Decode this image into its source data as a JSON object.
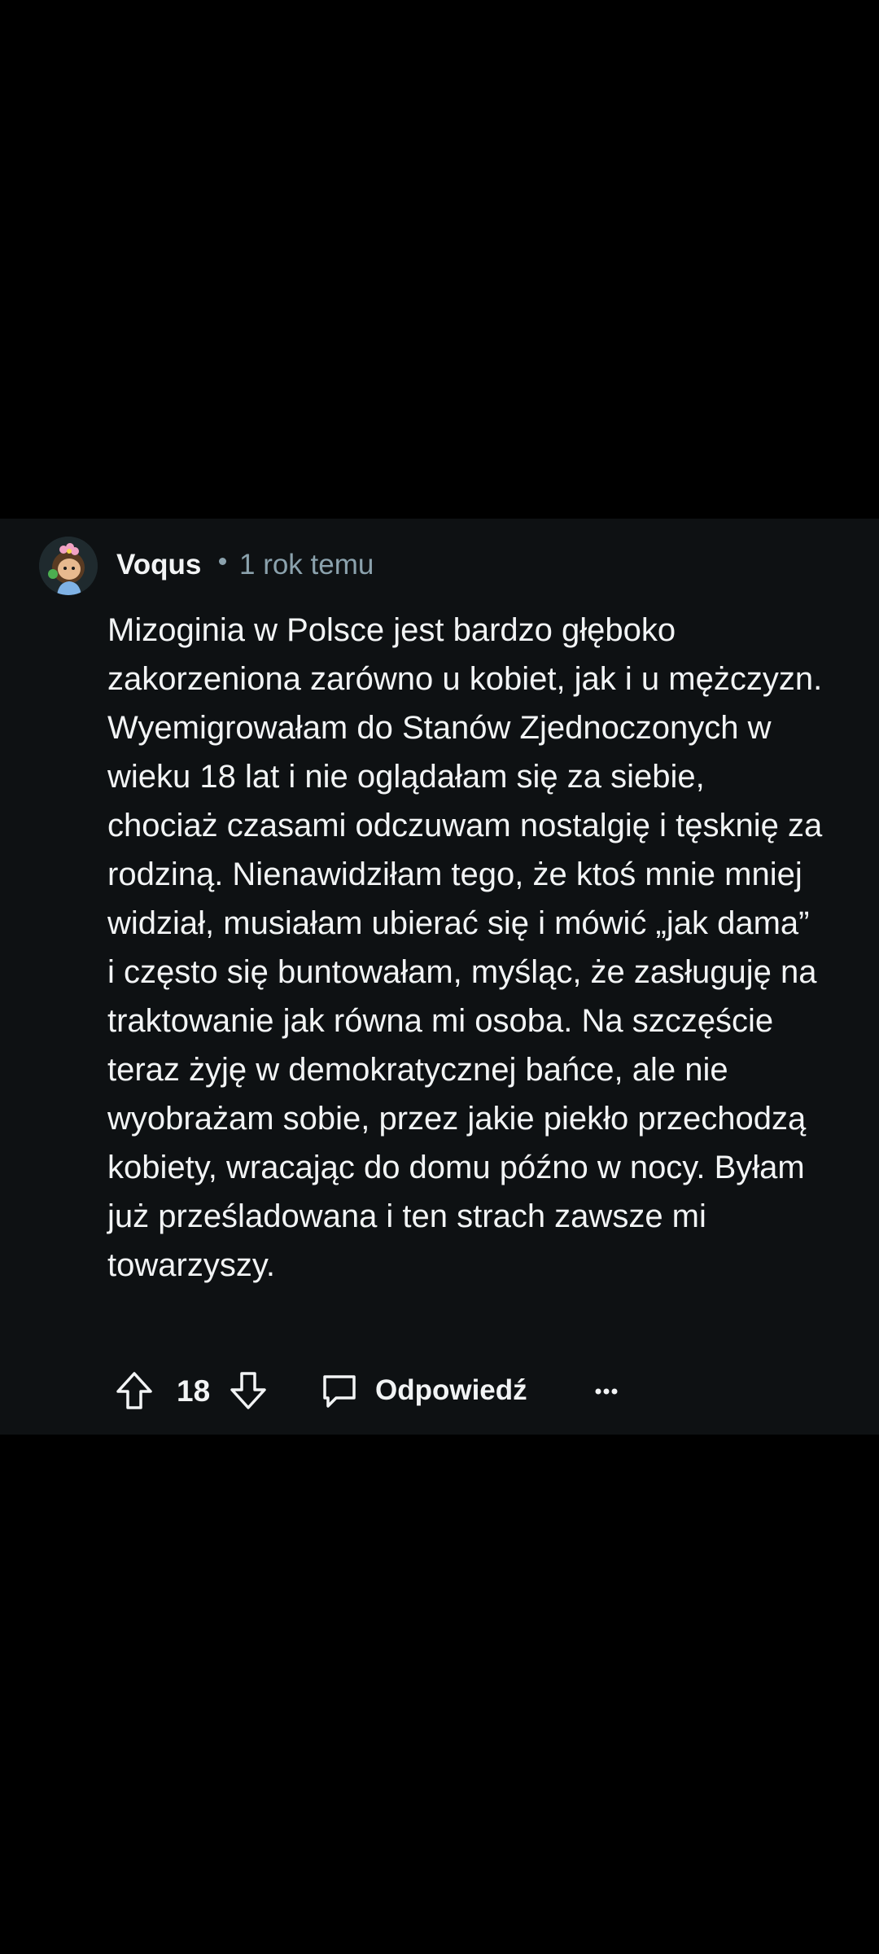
{
  "comment": {
    "author": "Voqus",
    "timestamp": "1 rok temu",
    "body": "Mizoginia w Polsce jest bardzo głęboko zakorzeniona zarówno u kobiet, jak i u mężczyzn. Wyemigrowałam do Stanów Zjednoczonych w wieku 18 lat i nie oglądałam się za siebie, chociaż czasami odczuwam nostalgię i tęsknię za rodziną. Nienawidziłam tego, że ktoś mnie mniej widział, musiałam ubierać się i mówić „jak dama” i często się buntowałam, myśląc, że zasługuję na traktowanie jak równa mi osoba. Na szczęście teraz żyję w demokratycznej bańce, ale nie wyobrażam sobie, przez jakie piekło przechodzą kobiety, wracając do domu późno w nocy. Byłam już prześladowana i ten strach zawsze mi towarzyszy.",
    "score": "18"
  },
  "actions": {
    "reply_label": "Odpowiedź"
  },
  "icons": {
    "upvote": "arrow-up-outline-icon",
    "downvote": "arrow-down-outline-icon",
    "reply": "speech-bubble-icon",
    "more": "horizontal-ellipsis-icon",
    "avatar": "cartoon-avatar-with-flower"
  },
  "colors": {
    "page_background": "#000000",
    "card_background": "#0e1113",
    "primary_text": "#f2f4f5",
    "secondary_text": "#8ba2ad"
  }
}
